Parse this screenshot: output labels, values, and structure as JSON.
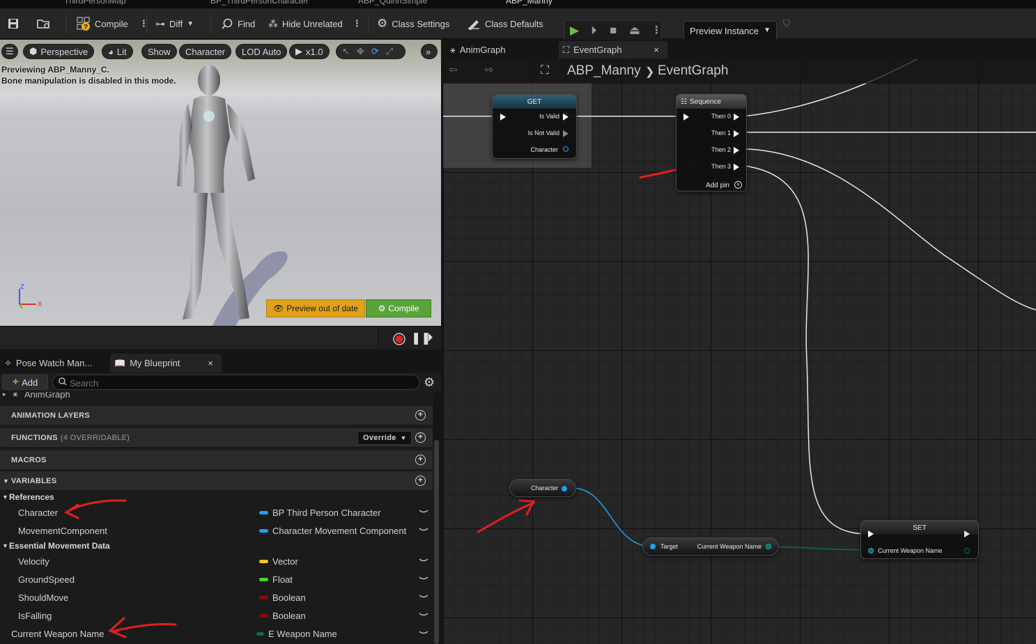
{
  "doc_tabs": [
    "ThirdPersonMap",
    "BP_ThirdPersonCharacter",
    "ABP_QuinnSimple",
    "ABP_Manny"
  ],
  "toolbar": {
    "compile": "Compile",
    "diff": "Diff",
    "find": "Find",
    "hide_unrelated": "Hide Unrelated",
    "class_settings": "Class Settings",
    "class_defaults": "Class Defaults",
    "preview_instance": "Preview Instance"
  },
  "viewport": {
    "buttons": [
      "Perspective",
      "Lit",
      "Show",
      "Character",
      "LOD Auto",
      "x1.0"
    ],
    "info_line1": "Previewing ABP_Manny_C.",
    "info_line2": "Bone manipulation is disabled in this mode.",
    "preview_out_of_date": "Preview out of date",
    "compile": "Compile",
    "axis_z": "Z",
    "axis_x": "X"
  },
  "left_panel": {
    "tab_pose_watch": "Pose Watch Man...",
    "tab_my_blueprint": "My Blueprint",
    "add_label": "Add",
    "search_placeholder": "Search",
    "animgraph_item": "AnimGraph",
    "sections": {
      "animation_layers": "ANIMATION LAYERS",
      "functions": "FUNCTIONS",
      "functions_note": "(4 OVERRIDABLE)",
      "override": "Override",
      "macros": "MACROS",
      "variables": "VARIABLES"
    },
    "categories": {
      "references": "References",
      "essential": "Essential Movement Data"
    },
    "variables": [
      {
        "name": "Character",
        "type": "BP Third Person Character",
        "color": "#1aa3f0"
      },
      {
        "name": "MovementComponent",
        "type": "Character Movement Component",
        "color": "#1aa3f0"
      },
      {
        "name": "Velocity",
        "type": "Vector",
        "color": "#f5c518"
      },
      {
        "name": "GroundSpeed",
        "type": "Float",
        "color": "#4ad32a"
      },
      {
        "name": "ShouldMove",
        "type": "Boolean",
        "color": "#8a0a0a"
      },
      {
        "name": "IsFalling",
        "type": "Boolean",
        "color": "#8a0a0a"
      },
      {
        "name": "Current Weapon Name",
        "type": "E Weapon Name",
        "color": "#0e6a5e"
      }
    ]
  },
  "graph": {
    "tab_animgraph": "AnimGraph",
    "tab_eventgraph": "EventGraph",
    "breadcrumb_root": "ABP_Manny",
    "breadcrumb_leaf": "EventGraph",
    "get_node": {
      "title": "GET",
      "is_valid": "Is Valid",
      "is_not_valid": "Is Not Valid",
      "character": "Character"
    },
    "sequence_node": {
      "title": "Sequence",
      "then0": "Then 0",
      "then1": "Then 1",
      "then2": "Then 2",
      "then3": "Then 3",
      "add_pin": "Add pin"
    },
    "character_node": "Character",
    "cast_node": {
      "target": "Target",
      "output": "Current Weapon Name"
    },
    "set_node": {
      "title": "SET",
      "input": "Current Weapon Name"
    }
  }
}
